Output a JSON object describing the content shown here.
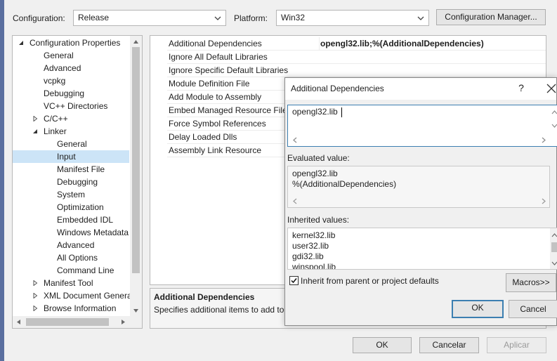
{
  "config_bar": {
    "configuration_label": "Configuration:",
    "configuration_value": "Release",
    "platform_label": "Platform:",
    "platform_value": "Win32",
    "config_manager_button": "Configuration Manager..."
  },
  "tree": {
    "items": [
      {
        "label": "Configuration Properties",
        "expander": "expanded"
      },
      {
        "label": "General"
      },
      {
        "label": "Advanced"
      },
      {
        "label": "vcpkg"
      },
      {
        "label": "Debugging"
      },
      {
        "label": "VC++ Directories"
      },
      {
        "label": "C/C++",
        "expander": "collapsed"
      },
      {
        "label": "Linker",
        "expander": "expanded"
      },
      {
        "label": "General"
      },
      {
        "label": "Input",
        "selected": true
      },
      {
        "label": "Manifest File"
      },
      {
        "label": "Debugging"
      },
      {
        "label": "System"
      },
      {
        "label": "Optimization"
      },
      {
        "label": "Embedded IDL"
      },
      {
        "label": "Windows Metadata"
      },
      {
        "label": "Advanced"
      },
      {
        "label": "All Options"
      },
      {
        "label": "Command Line"
      },
      {
        "label": "Manifest Tool",
        "expander": "collapsed"
      },
      {
        "label": "XML Document Genera",
        "expander": "collapsed"
      },
      {
        "label": "Browse Information",
        "expander": "collapsed"
      }
    ]
  },
  "properties": {
    "rows": [
      {
        "name": "Additional Dependencies",
        "value": "opengl32.lib;%(AdditionalDependencies)"
      },
      {
        "name": "Ignore All Default Libraries",
        "value": ""
      },
      {
        "name": "Ignore Specific Default Libraries",
        "value": ""
      },
      {
        "name": "Module Definition File",
        "value": ""
      },
      {
        "name": "Add Module to Assembly",
        "value": ""
      },
      {
        "name": "Embed Managed Resource File",
        "value": ""
      },
      {
        "name": "Force Symbol References",
        "value": ""
      },
      {
        "name": "Delay Loaded Dlls",
        "value": ""
      },
      {
        "name": "Assembly Link Resource",
        "value": ""
      }
    ]
  },
  "description": {
    "title": "Additional Dependencies",
    "text": "Specifies additional items to add to"
  },
  "footer": {
    "ok": "OK",
    "cancel": "Cancelar",
    "apply": "Aplicar"
  },
  "dialog": {
    "title": "Additional Dependencies",
    "help_glyph": "?",
    "close_glyph": "✕",
    "edit_lines": [
      "opengl32.lib"
    ],
    "evaluated_label": "Evaluated value:",
    "evaluated_lines": [
      "opengl32.lib",
      "%(AdditionalDependencies)"
    ],
    "inherited_label": "Inherited values:",
    "inherited_lines": [
      "kernel32.lib",
      "user32.lib",
      "gdi32.lib",
      "winspool.lib"
    ],
    "inherit_checkbox_label": "Inherit from parent or project defaults",
    "inherit_checked": true,
    "macros_button": "Macros>>",
    "ok": "OK",
    "cancel": "Cancel"
  },
  "colors": {
    "selection": "#cce4f7",
    "default_button_border": "#3c7fb1",
    "window_frame": "#5a6f9f"
  }
}
